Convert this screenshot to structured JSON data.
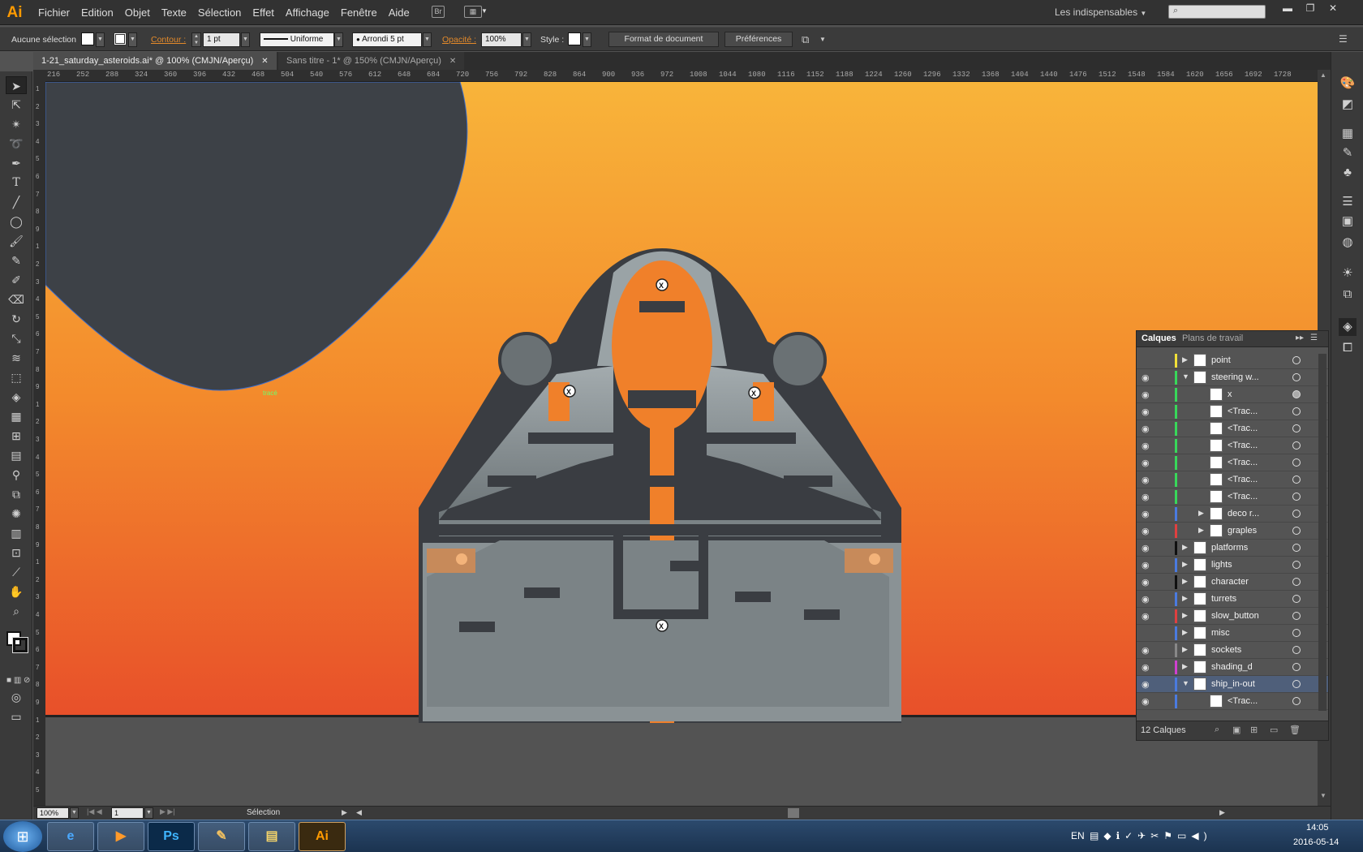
{
  "app": {
    "logo": "Ai",
    "workspace": "Les indispensables",
    "workspace_icon": "chevron-down-icon"
  },
  "menu": [
    "Fichier",
    "Edition",
    "Objet",
    "Texte",
    "Sélection",
    "Effet",
    "Affichage",
    "Fenêtre",
    "Aide"
  ],
  "menubar_icons": {
    "bridge": "Br"
  },
  "window_controls": {
    "minimize": "▬",
    "restore": "❐",
    "close": "✕"
  },
  "control_bar": {
    "selection_status": "Aucune sélection",
    "stroke_label": "Contour :",
    "stroke_weight": "1 pt",
    "stroke_profile": "Uniforme",
    "brush": "Arrondi 5 pt",
    "opacity_label": "Opacité :",
    "opacity": "100%",
    "style_label": "Style :",
    "doc_setup": "Format de document",
    "preferences": "Préférences"
  },
  "tabs": [
    {
      "label": "1-21_saturday_asteroids.ai* @ 100% (CMJN/Aperçu)",
      "active": true
    },
    {
      "label": "Sans titre - 1* @ 150% (CMJN/Aperçu)",
      "active": false
    }
  ],
  "ruler_h": [
    "216",
    "252",
    "288",
    "324",
    "360",
    "396",
    "432",
    "468",
    "504",
    "540",
    "576",
    "612",
    "648",
    "684",
    "720",
    "756",
    "792",
    "828",
    "864",
    "900",
    "936",
    "972",
    "1008",
    "1044",
    "1080",
    "1116",
    "1152",
    "1188",
    "1224",
    "1260",
    "1296",
    "1332",
    "1368",
    "1404",
    "1440",
    "1476",
    "1512",
    "1548",
    "1584",
    "1620",
    "1656",
    "1692",
    "1728"
  ],
  "ruler_v": [
    "1",
    "2",
    "3",
    "4",
    "5",
    "6",
    "7",
    "8",
    "9",
    "1",
    "2",
    "3",
    "4",
    "5",
    "6",
    "7",
    "8",
    "9",
    "1",
    "2",
    "3",
    "4",
    "5",
    "6",
    "7",
    "8",
    "9",
    "1",
    "2",
    "3",
    "4",
    "5",
    "6",
    "7",
    "8",
    "9",
    "1",
    "2",
    "3",
    "4",
    "5"
  ],
  "canvas": {
    "path_label": "tracé",
    "marker": "X"
  },
  "layers_panel": {
    "tab_layers": "Calques",
    "tab_artboards": "Plans de travail",
    "count": "12 Calques",
    "rows": [
      {
        "name": "point",
        "indent": 0,
        "eye": false,
        "arrow": "▶",
        "color": "#f2e038",
        "target_on": false,
        "selected": false
      },
      {
        "name": "steering w...",
        "indent": 0,
        "eye": true,
        "arrow": "▼",
        "color": "#38d85a",
        "target_on": false,
        "selected": false
      },
      {
        "name": "x",
        "indent": 1,
        "eye": true,
        "arrow": "",
        "color": "#38d85a",
        "target_on": true,
        "selected": false
      },
      {
        "name": "<Trac...",
        "indent": 1,
        "eye": true,
        "arrow": "",
        "color": "#38d85a",
        "target_on": false,
        "selected": false
      },
      {
        "name": "<Trac...",
        "indent": 1,
        "eye": true,
        "arrow": "",
        "color": "#38d85a",
        "target_on": false,
        "selected": false
      },
      {
        "name": "<Trac...",
        "indent": 1,
        "eye": true,
        "arrow": "",
        "color": "#38d85a",
        "target_on": false,
        "selected": false
      },
      {
        "name": "<Trac...",
        "indent": 1,
        "eye": true,
        "arrow": "",
        "color": "#38d85a",
        "target_on": false,
        "selected": false
      },
      {
        "name": "<Trac...",
        "indent": 1,
        "eye": true,
        "arrow": "",
        "color": "#38d85a",
        "target_on": false,
        "selected": false
      },
      {
        "name": "<Trac...",
        "indent": 1,
        "eye": true,
        "arrow": "",
        "color": "#38d85a",
        "target_on": false,
        "selected": false
      },
      {
        "name": "deco r...",
        "indent": 1,
        "eye": true,
        "arrow": "▶",
        "color": "#4a7be0",
        "target_on": false,
        "selected": false
      },
      {
        "name": "graples",
        "indent": 1,
        "eye": true,
        "arrow": "▶",
        "color": "#e04040",
        "target_on": false,
        "selected": false
      },
      {
        "name": "platforms",
        "indent": 0,
        "eye": true,
        "arrow": "▶",
        "color": "#111111",
        "target_on": false,
        "selected": false
      },
      {
        "name": "lights",
        "indent": 0,
        "eye": true,
        "arrow": "▶",
        "color": "#4a7be0",
        "target_on": false,
        "selected": false
      },
      {
        "name": "character",
        "indent": 0,
        "eye": true,
        "arrow": "▶",
        "color": "#111111",
        "target_on": false,
        "selected": false
      },
      {
        "name": "turrets",
        "indent": 0,
        "eye": true,
        "arrow": "▶",
        "color": "#4a7be0",
        "target_on": false,
        "selected": false
      },
      {
        "name": "slow_button",
        "indent": 0,
        "eye": true,
        "arrow": "▶",
        "color": "#e04040",
        "target_on": false,
        "selected": false
      },
      {
        "name": "misc",
        "indent": 0,
        "eye": false,
        "arrow": "▶",
        "color": "#4a7be0",
        "target_on": false,
        "selected": false
      },
      {
        "name": "sockets",
        "indent": 0,
        "eye": true,
        "arrow": "▶",
        "color": "#888888",
        "target_on": false,
        "selected": false
      },
      {
        "name": "shading_d",
        "indent": 0,
        "eye": true,
        "arrow": "▶",
        "color": "#d040d0",
        "target_on": false,
        "selected": false
      },
      {
        "name": "ship_in-out",
        "indent": 0,
        "eye": true,
        "arrow": "▼",
        "color": "#4a7be0",
        "target_on": false,
        "selected": true
      },
      {
        "name": "<Trac...",
        "indent": 1,
        "eye": true,
        "arrow": "",
        "color": "#4a7be0",
        "target_on": false,
        "selected": false
      }
    ]
  },
  "status_bar": {
    "zoom": "100%",
    "page": "1",
    "tool": "Sélection"
  },
  "taskbar": {
    "apps": [
      "Ps",
      "Ai"
    ],
    "lang": "EN",
    "time": "14:05",
    "date": "2016-05-14"
  },
  "colors": {
    "accent_orange": "#e48a2a",
    "canvas_top": "#f8b43a",
    "canvas_bottom": "#e8502a",
    "asteroid": "#3d4147",
    "ship_dark": "#3a3d42",
    "ship_panel": "#8e9699"
  }
}
